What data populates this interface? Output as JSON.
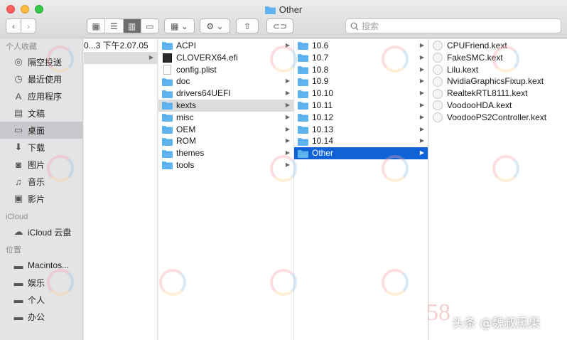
{
  "window": {
    "title": "Other",
    "folder_icon": "folder-icon",
    "close_color": "#fc605c",
    "minimize_color": "#fdbc40",
    "zoom_color": "#34c84a"
  },
  "toolbar": {
    "back_glyph": "‹",
    "forward_glyph": "›",
    "view_icon_glyph": "▦",
    "view_list_glyph": "☰",
    "view_column_glyph": "▥",
    "view_gallery_glyph": "▭",
    "group_glyph": "▦ ⌄",
    "action_glyph": "⚙ ⌄",
    "share_glyph": "⇧",
    "tag_glyph": "⊂⊃",
    "search_placeholder": "搜索"
  },
  "sidebar": {
    "favorites_heading": "个人收藏",
    "favorites": [
      {
        "label": "隔空投送",
        "icon": "airdrop-icon",
        "glyph": "◎"
      },
      {
        "label": "最近使用",
        "icon": "clock-icon",
        "glyph": "◷"
      },
      {
        "label": "应用程序",
        "icon": "applications-icon",
        "glyph": "A"
      },
      {
        "label": "文稿",
        "icon": "document-icon",
        "glyph": "▤"
      },
      {
        "label": "桌面",
        "icon": "desktop-icon",
        "glyph": "▭",
        "selected": true
      },
      {
        "label": "下载",
        "icon": "download-icon",
        "glyph": "⬇"
      },
      {
        "label": "图片",
        "icon": "camera-icon",
        "glyph": "◙"
      },
      {
        "label": "音乐",
        "icon": "music-icon",
        "glyph": "♫"
      },
      {
        "label": "影片",
        "icon": "film-icon",
        "glyph": "▣"
      }
    ],
    "icloud_heading": "iCloud",
    "icloud": [
      {
        "label": "iCloud 云盘",
        "icon": "cloud-icon",
        "glyph": "☁"
      }
    ],
    "locations_heading": "位置",
    "locations": [
      {
        "label": "Macintos...",
        "icon": "disk-icon",
        "glyph": "▬"
      },
      {
        "label": "娱乐",
        "icon": "disk-icon",
        "glyph": "▬"
      },
      {
        "label": "个人",
        "icon": "disk-icon",
        "glyph": "▬"
      },
      {
        "label": "办公",
        "icon": "disk-icon",
        "glyph": "▬"
      }
    ]
  },
  "columns": {
    "col1": [
      {
        "label": "0...3 下午2.07.05",
        "arrow": ""
      },
      {
        "label": "",
        "arrow": "▶",
        "highlight": true
      }
    ],
    "col2": [
      {
        "label": "ACPI",
        "type": "folder",
        "arrow": "▶"
      },
      {
        "label": "CLOVERX64.efi",
        "type": "efi",
        "arrow": ""
      },
      {
        "label": "config.plist",
        "type": "plist",
        "arrow": ""
      },
      {
        "label": "doc",
        "type": "folder",
        "arrow": "▶"
      },
      {
        "label": "drivers64UEFI",
        "type": "folder",
        "arrow": "▶"
      },
      {
        "label": "kexts",
        "type": "folder",
        "arrow": "▶",
        "highlight": true
      },
      {
        "label": "misc",
        "type": "folder",
        "arrow": "▶"
      },
      {
        "label": "OEM",
        "type": "folder",
        "arrow": "▶"
      },
      {
        "label": "ROM",
        "type": "folder",
        "arrow": "▶"
      },
      {
        "label": "themes",
        "type": "folder",
        "arrow": "▶"
      },
      {
        "label": "tools",
        "type": "folder",
        "arrow": "▶"
      }
    ],
    "col3": [
      {
        "label": "10.6",
        "arrow": "▶"
      },
      {
        "label": "10.7",
        "arrow": "▶"
      },
      {
        "label": "10.8",
        "arrow": "▶"
      },
      {
        "label": "10.9",
        "arrow": "▶"
      },
      {
        "label": "10.10",
        "arrow": "▶"
      },
      {
        "label": "10.11",
        "arrow": "▶"
      },
      {
        "label": "10.12",
        "arrow": "▶"
      },
      {
        "label": "10.13",
        "arrow": "▶"
      },
      {
        "label": "10.14",
        "arrow": "▶"
      },
      {
        "label": "Other",
        "arrow": "▶",
        "selected": true
      }
    ],
    "col4": [
      {
        "label": "CPUFriend.kext"
      },
      {
        "label": "FakeSMC.kext"
      },
      {
        "label": "Lilu.kext"
      },
      {
        "label": "NvidiaGraphicsFixup.kext"
      },
      {
        "label": "RealtekRTL8111.kext"
      },
      {
        "label": "VoodooHDA.kext"
      },
      {
        "label": "VoodooPS2Controller.kext"
      }
    ]
  },
  "overlay": {
    "watermark_text": "头条 @魏叔黑果",
    "watermark_number": "58"
  },
  "colors": {
    "selection": "#0f63d6",
    "folder": "#5fb4ef",
    "sidebar_bg": "#e4e4e6"
  }
}
